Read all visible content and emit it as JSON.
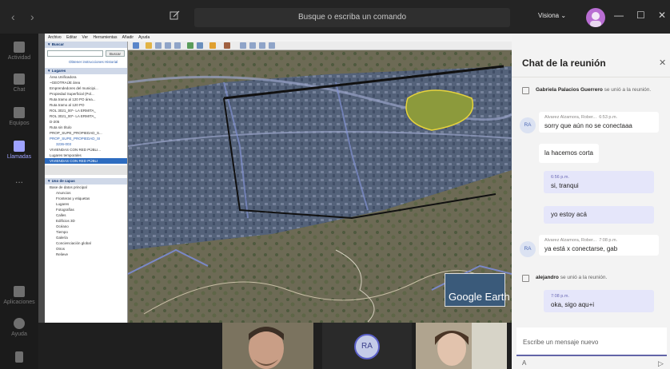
{
  "titlebar": {
    "search_placeholder": "Busque o escriba un comando",
    "user_name": "Visiona",
    "user_name_chevron": "⌄",
    "back_arrow": "‹",
    "forward_arrow": "›",
    "minimize": "—",
    "maximize": "☐",
    "close": "✕"
  },
  "rail": {
    "items": [
      {
        "label": "Actividad",
        "icon": "bell-icon"
      },
      {
        "label": "Chat",
        "icon": "chat-icon"
      },
      {
        "label": "Equipos",
        "icon": "teams-icon"
      },
      {
        "label": "Llamadas",
        "icon": "phone-icon"
      },
      {
        "label": "...",
        "icon": "more-icon"
      },
      {
        "label": "Aplicaciones",
        "icon": "apps-icon"
      },
      {
        "label": "Ayuda",
        "icon": "help-icon"
      }
    ]
  },
  "google_earth": {
    "menu": [
      "Archivo",
      "Editar",
      "Ver",
      "Herramientas",
      "Añadir",
      "Ayuda"
    ],
    "search_header": "▼ Buscar",
    "search_button": "Buscar",
    "search_links": "Obtener instrucciones Historial",
    "places_header": "▼ Lugares",
    "places": [
      "Área Unificadora",
      "~GEOTRAÚE área",
      "Emprendedores del municipi...",
      "Propiedad Superficial (Pol...",
      "Ruta tramo al 120 PO área...",
      "Ruta tramo al 120 PO",
      "ROL 3021_00*- LA ERMITA_",
      "ROL 3021_00*- LA ERMITA_",
      "D-205",
      "Ruta sin título",
      "PROP_SUPE_PROPIEDAD_S...",
      "PROP_SUPE_PROPIEDAD_SI",
      "3236-003",
      "VIVIENDAS CON RED PÚBLI...",
      "Lugares temporales",
      "VIVIENDAS CON RED PÚBLI"
    ],
    "layers_header": "▼ Uso de capas",
    "layers": [
      "Base de datos principal",
      "Anuncios",
      "Fronteras y etiquetas",
      "Lugares",
      "Fotografías",
      "Calles",
      "Edificios 3D",
      "Océano",
      "Tiempo",
      "Galería",
      "Concienciación global",
      "Otros",
      "Relieve"
    ],
    "logo_text": "Google Earth"
  },
  "participants": {
    "ra_initials": "RA"
  },
  "chat": {
    "title": "Chat de la reunión",
    "close": "✕",
    "messages": [
      {
        "type": "system",
        "name": "Gabriela Palacios Guerrero",
        "text": "se unió a la reunión."
      },
      {
        "type": "other",
        "badge": "RA",
        "sender": "Alvarez Alzamora, Rober...",
        "time": "6:53 p.m.",
        "text": "sorry que aún no se conectaaa"
      },
      {
        "type": "other_cont",
        "text": "la hacemos corta"
      },
      {
        "type": "mine",
        "time": "6:56 p.m.",
        "text": "si, tranqui"
      },
      {
        "type": "mine_cont",
        "text": "yo estoy acá"
      },
      {
        "type": "other",
        "badge": "RA",
        "sender": "Alvarez Alzamora, Rober...",
        "time": "7:08 p.m.",
        "text": "ya está x conectarse, gab"
      },
      {
        "type": "system",
        "name": "alejandro",
        "text": "se unió a la reunión."
      },
      {
        "type": "mine",
        "time": "7:08 p.m.",
        "text": "oka, sigo aqu+i"
      }
    ],
    "composer_placeholder": "Escribe un mensaje nuevo",
    "format_icon_glyph": "A",
    "send_icon_glyph": "▷"
  },
  "colors": {
    "accent": "#6264a7",
    "titlebar": "#242424",
    "chat_bg": "#f3f3f3",
    "my_message_bg": "#e5e6fa"
  }
}
